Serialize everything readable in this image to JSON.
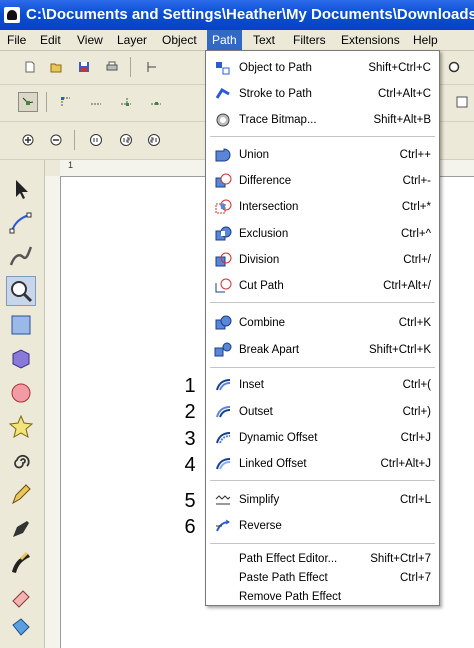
{
  "window": {
    "title": "C:\\Documents and Settings\\Heather\\My Documents\\Downloads\\tes"
  },
  "menubar": {
    "items": [
      "File",
      "Edit",
      "View",
      "Layer",
      "Object",
      "Path",
      "Text",
      "Filters",
      "Extensions",
      "Help"
    ],
    "active": "Path"
  },
  "ruler": {
    "h_label": "1"
  },
  "path_menu": {
    "items": [
      {
        "label": "Object to Path",
        "shortcut": "Shift+Ctrl+C",
        "icon": "object-to-path-icon"
      },
      {
        "label": "Stroke to Path",
        "shortcut": "Ctrl+Alt+C",
        "icon": "stroke-to-path-icon"
      },
      {
        "label": "Trace Bitmap...",
        "shortcut": "Shift+Alt+B",
        "icon": "trace-bitmap-icon"
      },
      {
        "label": "Union",
        "shortcut": "Ctrl++",
        "icon": "union-icon"
      },
      {
        "label": "Difference",
        "shortcut": "Ctrl+-",
        "icon": "difference-icon"
      },
      {
        "label": "Intersection",
        "shortcut": "Ctrl+*",
        "icon": "intersection-icon"
      },
      {
        "label": "Exclusion",
        "shortcut": "Ctrl+^",
        "icon": "exclusion-icon"
      },
      {
        "label": "Division",
        "shortcut": "Ctrl+/",
        "icon": "division-icon"
      },
      {
        "label": "Cut Path",
        "shortcut": "Ctrl+Alt+/",
        "icon": "cut-path-icon"
      },
      {
        "label": "Combine",
        "shortcut": "Ctrl+K",
        "icon": "combine-icon"
      },
      {
        "label": "Break Apart",
        "shortcut": "Shift+Ctrl+K",
        "icon": "break-apart-icon"
      },
      {
        "label": "Inset",
        "shortcut": "Ctrl+(",
        "icon": "inset-icon"
      },
      {
        "label": "Outset",
        "shortcut": "Ctrl+)",
        "icon": "outset-icon"
      },
      {
        "label": "Dynamic Offset",
        "shortcut": "Ctrl+J",
        "icon": "dynamic-offset-icon"
      },
      {
        "label": "Linked Offset",
        "shortcut": "Ctrl+Alt+J",
        "icon": "linked-offset-icon"
      },
      {
        "label": "Simplify",
        "shortcut": "Ctrl+L",
        "icon": "simplify-icon"
      },
      {
        "label": "Reverse",
        "shortcut": "",
        "icon": "reverse-icon"
      },
      {
        "label": "Path Effect Editor...",
        "shortcut": "Shift+Ctrl+7",
        "icon": ""
      },
      {
        "label": "Paste Path Effect",
        "shortcut": "Ctrl+7",
        "icon": ""
      },
      {
        "label": "Remove Path Effect",
        "shortcut": "",
        "icon": ""
      }
    ]
  },
  "annotations": [
    "1",
    "2",
    "3",
    "4",
    "5",
    "6"
  ],
  "toolbox_icons": [
    "selector-icon",
    "node-editor-icon",
    "tweak-icon",
    "zoom-icon",
    "rectangle-icon",
    "3d-box-icon",
    "ellipse-icon",
    "star-icon",
    "spiral-icon",
    "pencil-icon",
    "pen-icon",
    "calligraphy-icon",
    "eraser-icon",
    "paint-bucket-icon"
  ]
}
